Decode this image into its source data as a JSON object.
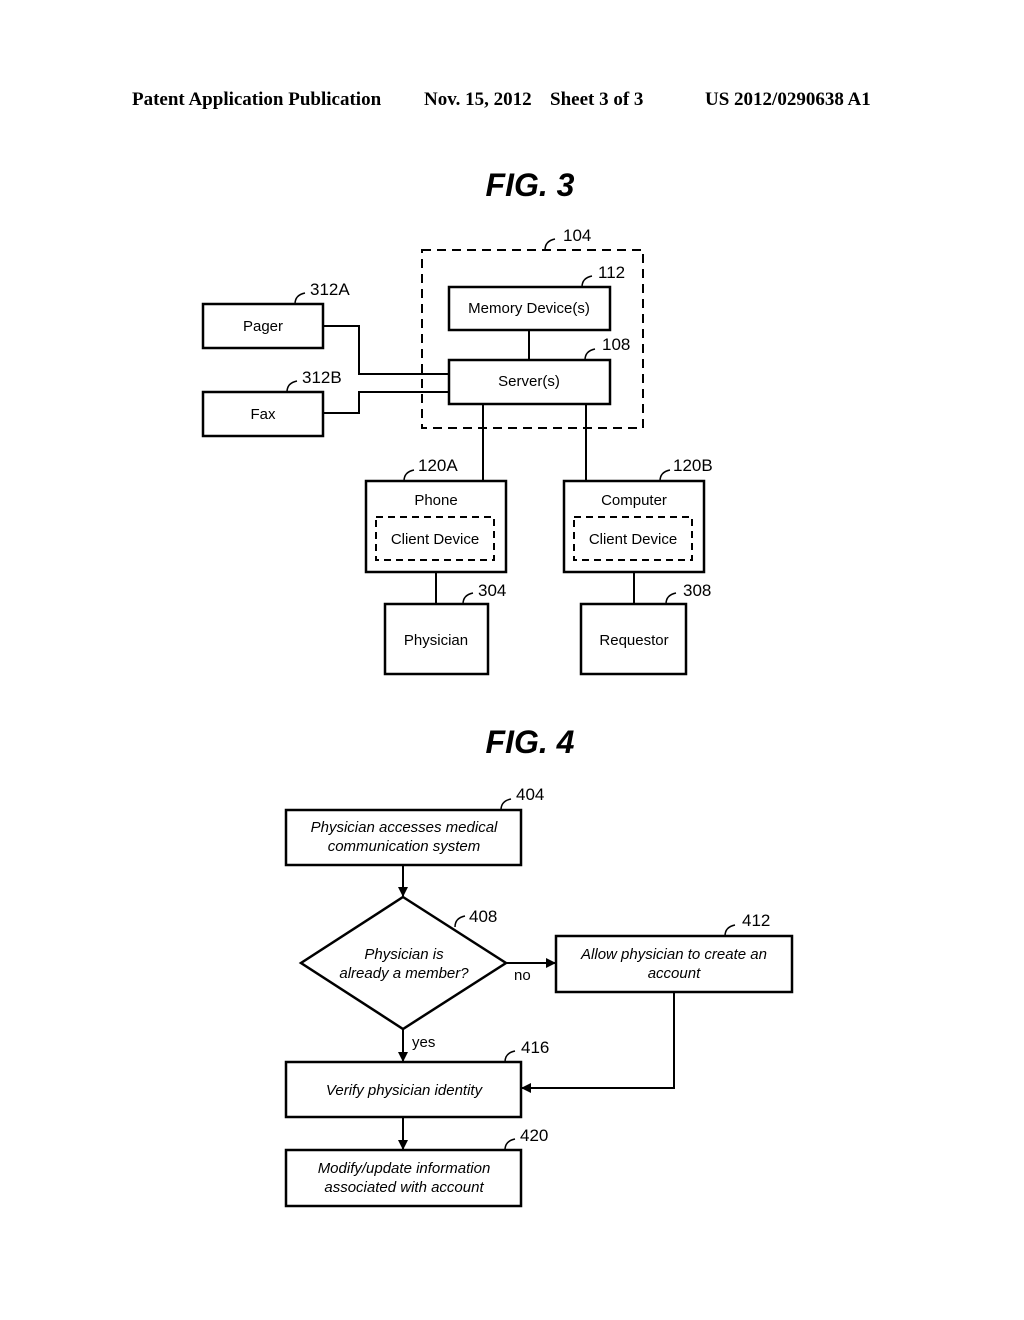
{
  "header": {
    "publication": "Patent Application Publication",
    "date": "Nov. 15, 2012",
    "sheet": "Sheet 3 of 3",
    "number": "US 2012/0290638 A1"
  },
  "fig3": {
    "title": "FIG. 3",
    "system_ref": "104",
    "memory": {
      "label": "Memory Device(s)",
      "ref": "112"
    },
    "server": {
      "label": "Server(s)",
      "ref": "108"
    },
    "pager": {
      "label": "Pager",
      "ref": "312A"
    },
    "fax": {
      "label": "Fax",
      "ref": "312B"
    },
    "phone": {
      "label": "Phone",
      "inner": "Client Device",
      "ref": "120A"
    },
    "computer": {
      "label": "Computer",
      "inner": "Client Device",
      "ref": "120B"
    },
    "physician": {
      "label": "Physician",
      "ref": "304"
    },
    "requestor": {
      "label": "Requestor",
      "ref": "308"
    }
  },
  "fig4": {
    "title": "FIG. 4",
    "step404": {
      "line1": "Physician accesses medical",
      "line2": "communication system",
      "ref": "404"
    },
    "step408": {
      "line1": "Physician is",
      "line2": "already a member?",
      "ref": "408"
    },
    "step412": {
      "line1": "Allow physician to create an",
      "line2": "account",
      "ref": "412"
    },
    "step416": {
      "line1": "Verify physician identity",
      "ref": "416"
    },
    "step420": {
      "line1": "Modify/update information",
      "line2": "associated with account",
      "ref": "420"
    },
    "no_label": "no",
    "yes_label": "yes"
  }
}
